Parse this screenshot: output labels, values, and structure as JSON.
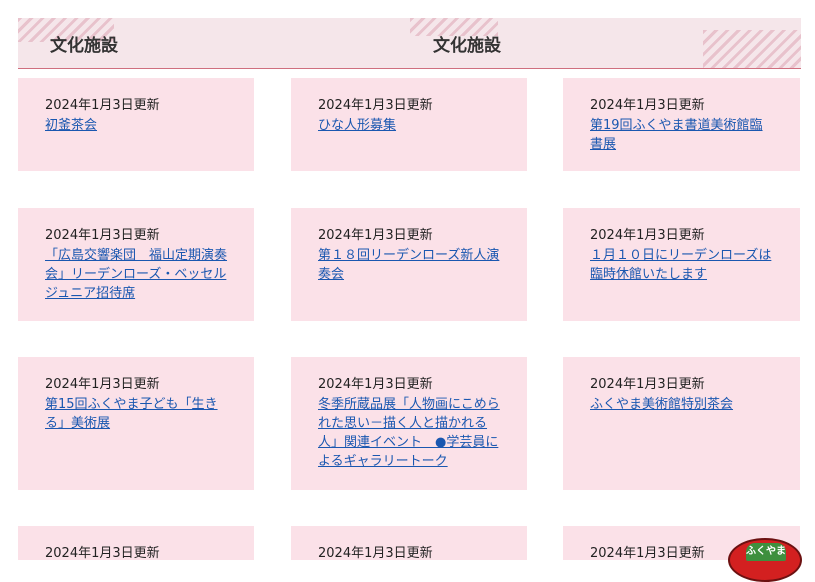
{
  "header": {
    "title_left": "文化施設",
    "title_center": "文化施設"
  },
  "cards": [
    {
      "date": "2024年1月3日更新",
      "title": "初釜茶会"
    },
    {
      "date": "2024年1月3日更新",
      "title": "ひな人形募集"
    },
    {
      "date": "2024年1月3日更新",
      "title": "第19回ふくやま書道美術館臨書展"
    },
    {
      "date": "2024年1月3日更新",
      "title": "「広島交響楽団　福山定期演奏会」リーデンローズ・ベッセルジュニア招待席"
    },
    {
      "date": "2024年1月3日更新",
      "title": "第１８回リーデンローズ新人演奏会"
    },
    {
      "date": "2024年1月3日更新",
      "title": "１月１０日にリーデンローズは臨時休館いたします"
    },
    {
      "date": "2024年1月3日更新",
      "title": "第15回ふくやま子ども「生きる」美術展"
    },
    {
      "date": "2024年1月3日更新",
      "title": "冬季所蔵品展「人物画にこめられた思い－描く人と描かれる人」関連イベント　●学芸員によるギャラリートーク"
    },
    {
      "date": "2024年1月3日更新",
      "title": "ふくやま美術館特別茶会"
    },
    {
      "date": "2024年1月3日更新",
      "title": ""
    },
    {
      "date": "2024年1月3日更新",
      "title": ""
    },
    {
      "date": "2024年1月3日更新",
      "title": ""
    }
  ],
  "mascot": {
    "label": "ふくやま"
  }
}
